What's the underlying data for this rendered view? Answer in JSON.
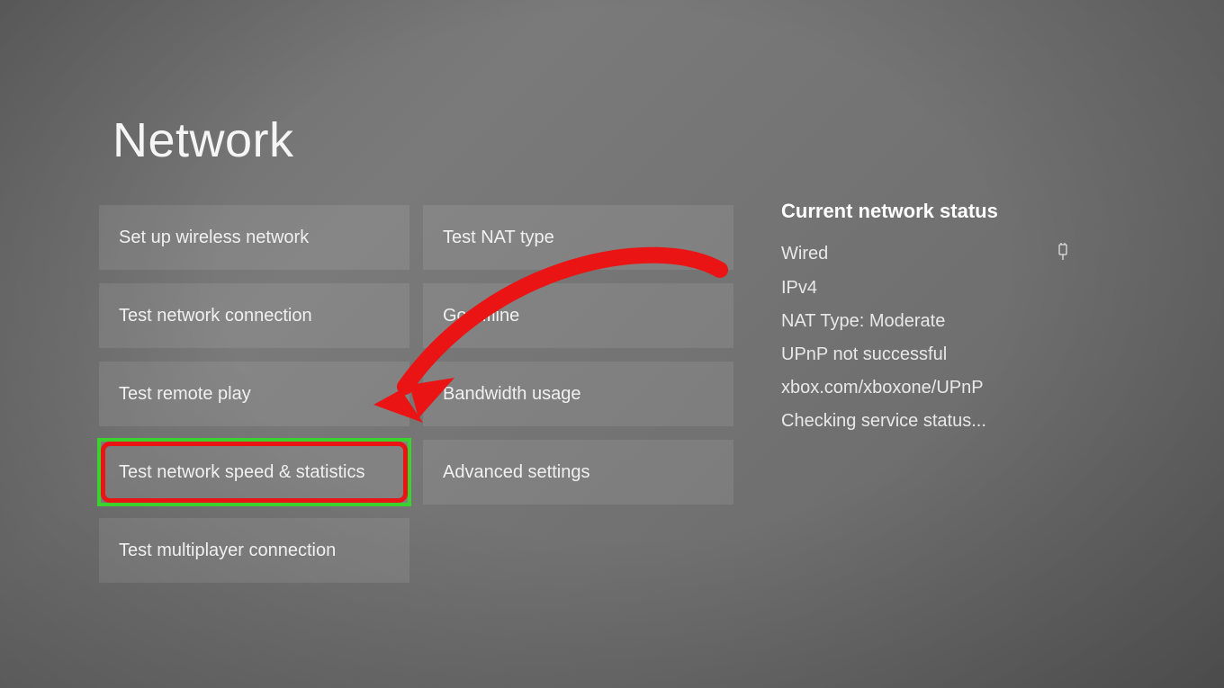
{
  "page_title": "Network",
  "column1": {
    "setup_wireless": "Set up wireless network",
    "test_connection": "Test network connection",
    "test_remote_play": "Test remote play",
    "test_speed_stats": "Test network speed & statistics",
    "test_multiplayer": "Test multiplayer connection"
  },
  "column2": {
    "test_nat": "Test NAT type",
    "go_offline": "Go offline",
    "bandwidth": "Bandwidth usage",
    "advanced": "Advanced settings"
  },
  "status": {
    "title": "Current network status",
    "connection_type": "Wired",
    "ip_version": "IPv4",
    "nat_type": "NAT Type: Moderate",
    "upnp": "UPnP not successful",
    "url": "xbox.com/xboxone/UPnP",
    "service_status": "Checking service status..."
  },
  "annotation": {
    "arrow_color": "#ea1414",
    "highlight_outer": "#3bd12e",
    "highlight_inner": "#ea1414"
  }
}
